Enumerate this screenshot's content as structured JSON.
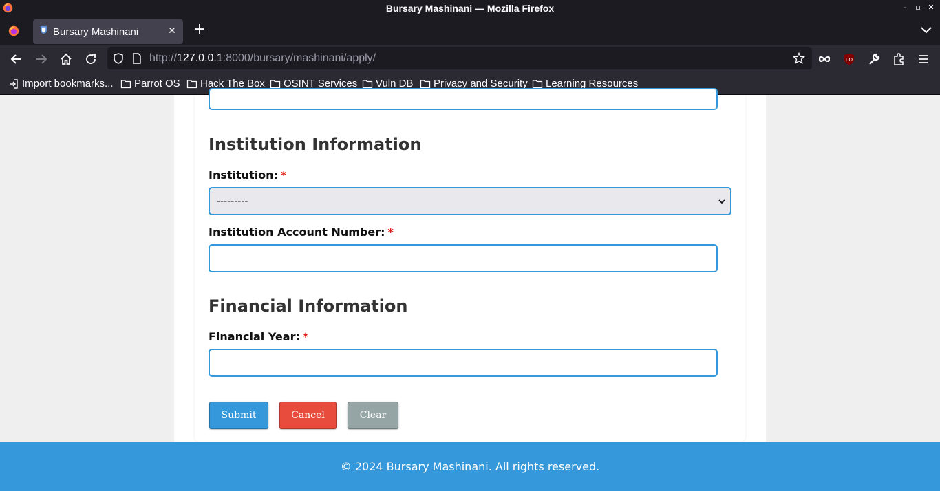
{
  "window": {
    "title": "Bursary Mashinani — Mozilla Firefox",
    "minimize": "–",
    "maximize": "▫",
    "close": "✕"
  },
  "tab": {
    "title": "Bursary Mashinani",
    "close": "✕",
    "new_tab": "+"
  },
  "urlbar": {
    "url_host": "127.0.0.1",
    "url_prefix": "http://",
    "url_suffix": ":8000/bursary/mashinani/apply/"
  },
  "bookmarks": [
    {
      "label": "Import bookmarks...",
      "icon": "import-icon"
    },
    {
      "label": "Parrot OS",
      "icon": "folder-icon"
    },
    {
      "label": "Hack The Box",
      "icon": "folder-icon"
    },
    {
      "label": "OSINT Services",
      "icon": "folder-icon"
    },
    {
      "label": "Vuln DB",
      "icon": "folder-icon"
    },
    {
      "label": "Privacy and Security",
      "icon": "folder-icon"
    },
    {
      "label": "Learning Resources",
      "icon": "folder-icon"
    }
  ],
  "form": {
    "institution_section": "Institution Information",
    "institution_label": "Institution:",
    "institution_value": "---------",
    "account_label": "Institution Account Number:",
    "account_value": "",
    "financial_section": "Financial Information",
    "year_label": "Financial Year:",
    "year_value": "",
    "required_mark": "*",
    "submit": "Submit",
    "cancel": "Cancel",
    "clear": "Clear"
  },
  "footer": {
    "text": "© 2024 Bursary Mashinani. All rights reserved."
  },
  "colors": {
    "accent": "#3498db",
    "danger": "#e74c3c",
    "neutral": "#95a5a6",
    "required": "#e41b1b"
  }
}
